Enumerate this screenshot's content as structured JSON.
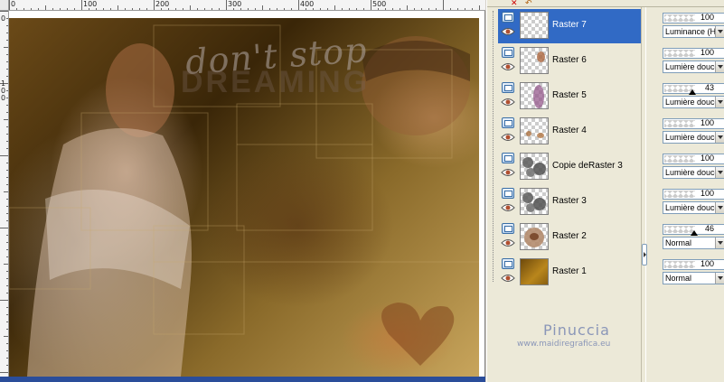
{
  "ruler": {
    "top_marks": [
      "0",
      "100",
      "200",
      "300",
      "400",
      "500"
    ],
    "left_marks": [
      "0",
      "1",
      "0",
      "0"
    ]
  },
  "canvas": {
    "title_line1": "don't stop",
    "title_line2": "DREAMING"
  },
  "layers": [
    {
      "name": "Raster 7",
      "opacity": "100",
      "blend": "Luminance (H)",
      "selected": true,
      "thumb": "empty"
    },
    {
      "name": "Raster 6",
      "opacity": "100",
      "blend": "Lumière douce",
      "selected": false,
      "thumb": "spot"
    },
    {
      "name": "Raster 5",
      "opacity": "43",
      "blend": "Lumière douce",
      "selected": false,
      "thumb": "purple"
    },
    {
      "name": "Raster 4",
      "opacity": "100",
      "blend": "Lumière douce",
      "selected": false,
      "thumb": "dots"
    },
    {
      "name": "Copie deRaster 3",
      "opacity": "100",
      "blend": "Lumière douce",
      "selected": false,
      "thumb": "grey"
    },
    {
      "name": "Raster 3",
      "opacity": "100",
      "blend": "Lumière douce",
      "selected": false,
      "thumb": "grey"
    },
    {
      "name": "Raster 2",
      "opacity": "46",
      "blend": "Normal",
      "selected": false,
      "thumb": "face"
    },
    {
      "name": "Raster 1",
      "opacity": "100",
      "blend": "Normal",
      "selected": false,
      "thumb": "gold"
    }
  ],
  "watermark": {
    "name": "Pinuccia",
    "url": "www.maidiregrafica.eu"
  },
  "colors": {
    "selection": "#316ac5",
    "panel_bg": "#ece9d8",
    "watermark": "#8a96b8"
  }
}
